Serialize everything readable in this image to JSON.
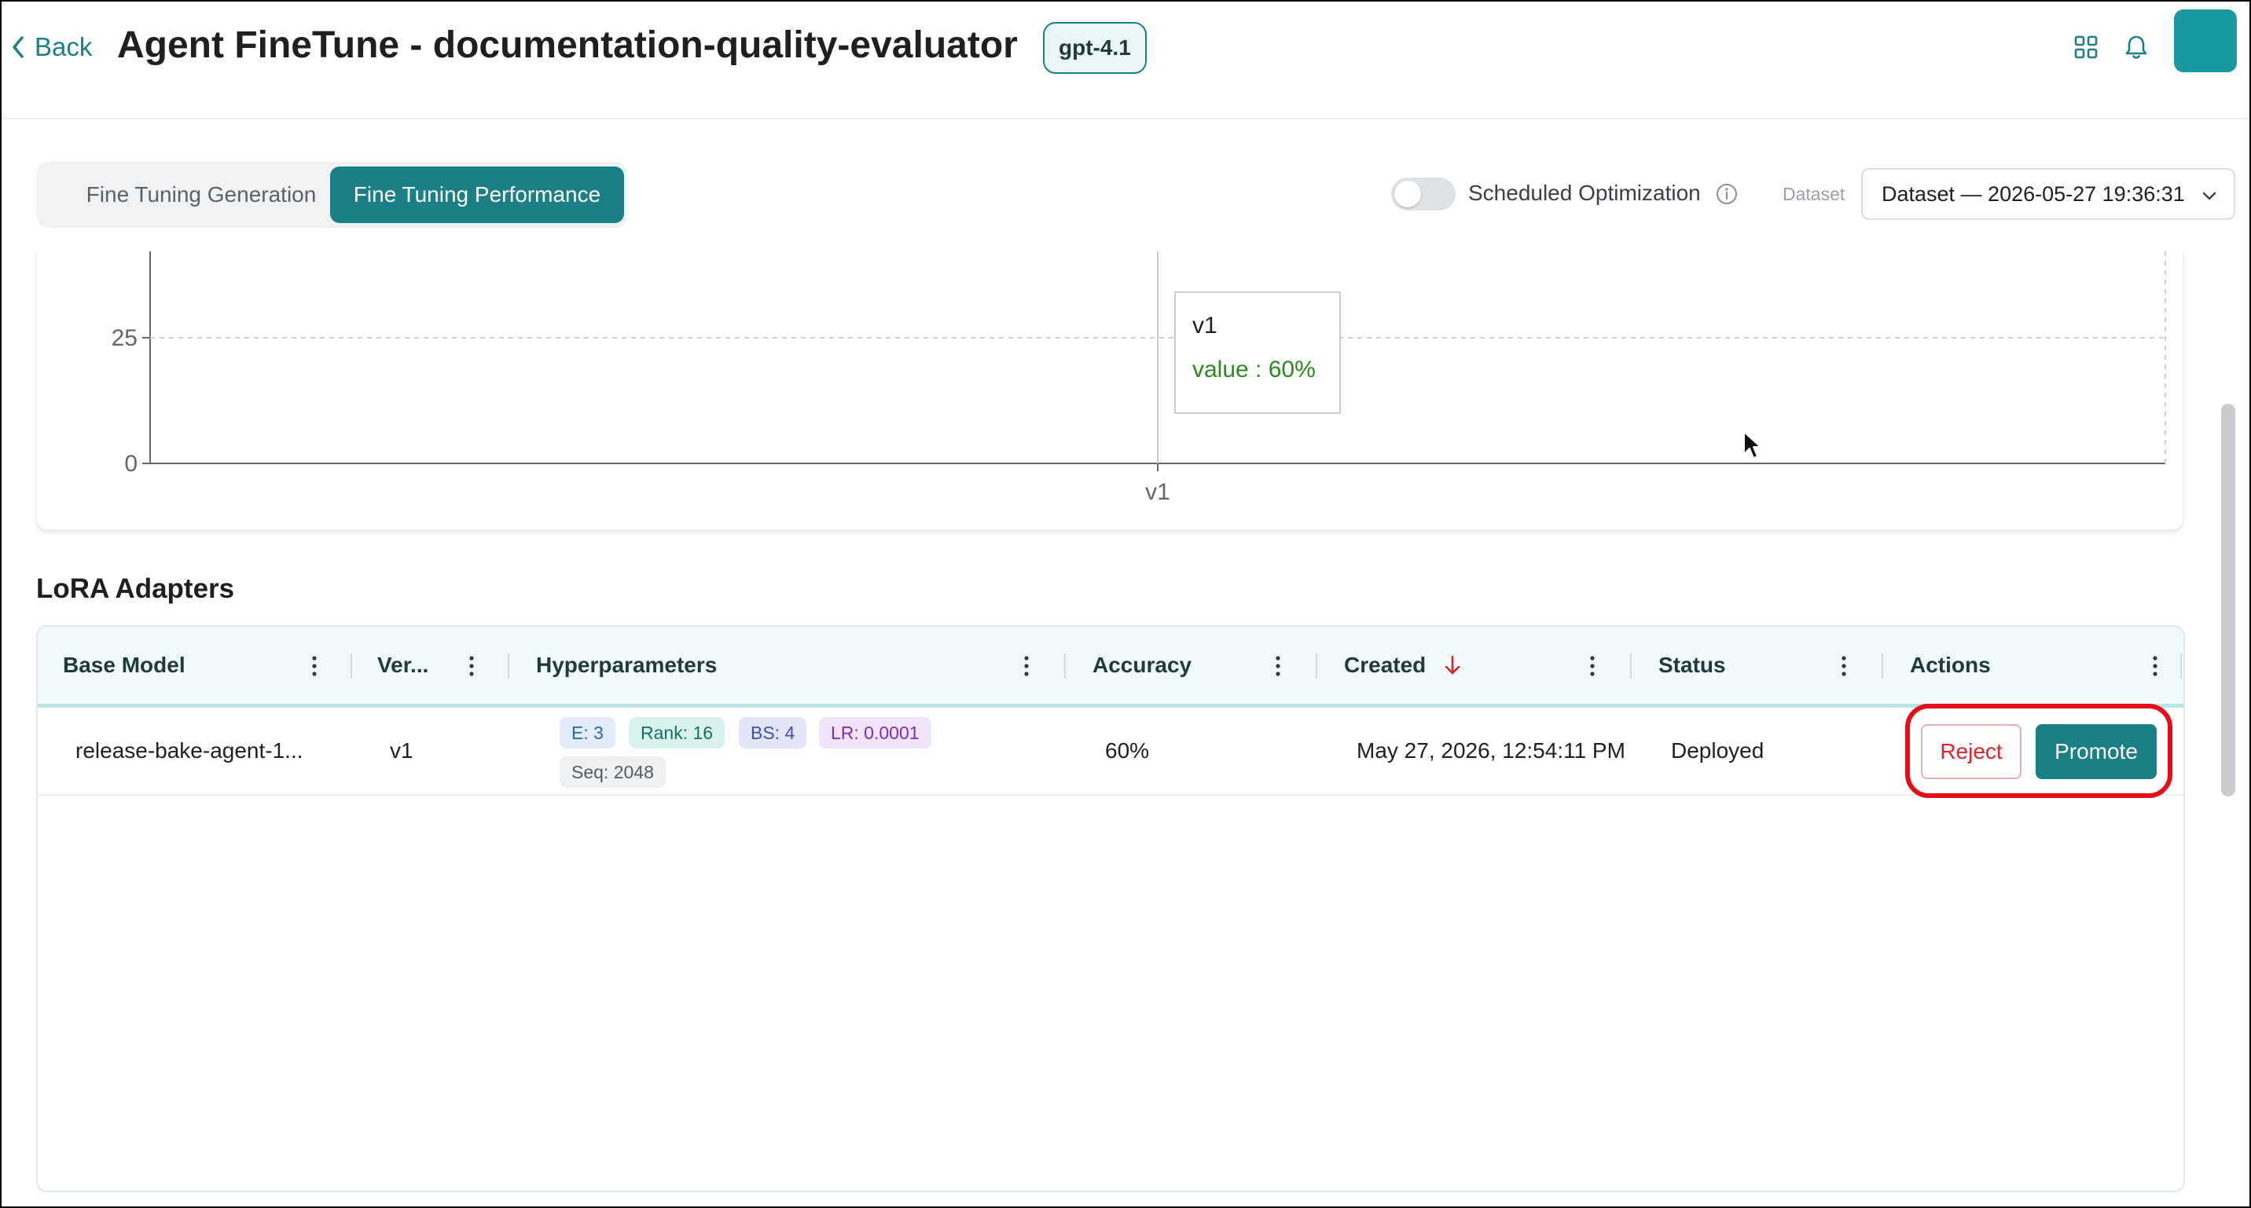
{
  "header": {
    "back_label": "Back",
    "title": "Agent FineTune - documentation-quality-evaluator",
    "model_badge": "gpt-4.1"
  },
  "tabs": [
    {
      "label": "Fine Tuning Generation",
      "active": false
    },
    {
      "label": "Fine Tuning Performance",
      "active": true
    }
  ],
  "scheduled_optimization": {
    "label": "Scheduled Optimization",
    "enabled": false
  },
  "dataset": {
    "label": "Dataset",
    "selected": "Dataset — 2026-05-27 19:36:31"
  },
  "chart_data": {
    "type": "bar",
    "categories": [
      "v1"
    ],
    "series": [
      {
        "values": [
          60
        ]
      }
    ],
    "y_ticks": [
      "25",
      "0"
    ],
    "tooltip": {
      "title": "v1",
      "text": "value : 60%"
    },
    "grid": true
  },
  "lora": {
    "title": "LoRA Adapters",
    "columns": [
      "Base Model",
      "Ver...",
      "Hyperparameters",
      "Accuracy",
      "Created",
      "Status",
      "Actions"
    ],
    "rows": [
      {
        "base_model": "release-bake-agent-1...",
        "version": "v1",
        "hyperparameters": [
          "E: 3",
          "Rank: 16",
          "BS: 4",
          "LR: 0.0001",
          "Seq: 2048"
        ],
        "accuracy": "60%",
        "created": "May 27, 2026, 12:54:11 PM",
        "status": "Deployed",
        "actions": {
          "reject": "Reject",
          "promote": "Promote"
        }
      }
    ]
  },
  "colors": {
    "accent": "#1a7f87",
    "reject": "#d9252b",
    "highlight": "#e30e1a",
    "tooltip_value": "#2a8a1f"
  }
}
